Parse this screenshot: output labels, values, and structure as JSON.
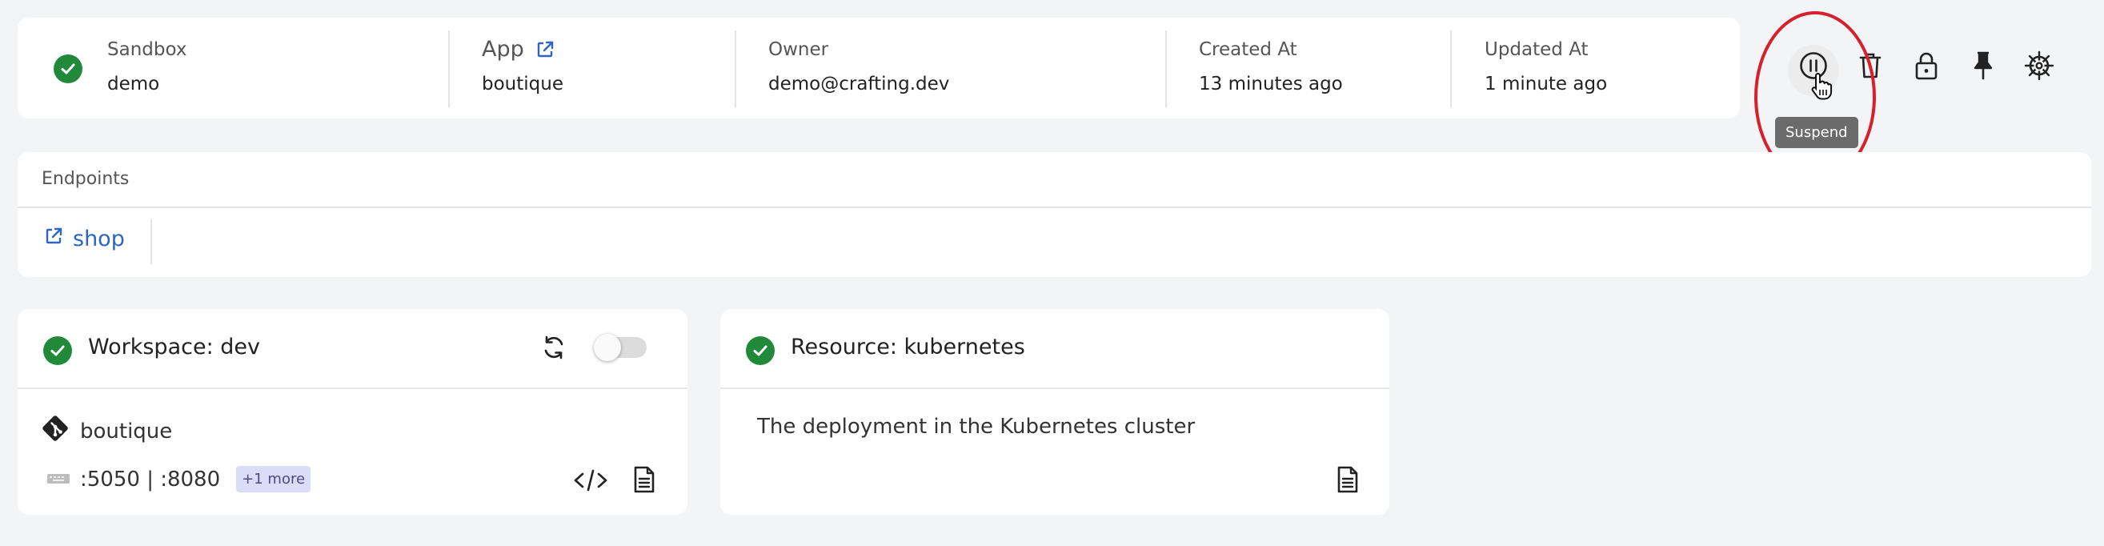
{
  "sandbox": {
    "label": "Sandbox",
    "name": "demo",
    "status": "ready"
  },
  "app": {
    "label": "App",
    "name": "boutique"
  },
  "owner": {
    "label": "Owner",
    "value": "demo@crafting.dev"
  },
  "created": {
    "label": "Created At",
    "value": "13 minutes ago"
  },
  "updated": {
    "label": "Updated At",
    "value": "1 minute ago"
  },
  "toolbar": {
    "actions": [
      "pause-icon",
      "trash-icon",
      "lock-icon",
      "pin-icon",
      "helm-icon"
    ],
    "tooltip": "Suspend"
  },
  "endpoints": {
    "title": "Endpoints",
    "items": [
      {
        "label": "shop"
      }
    ]
  },
  "workspace": {
    "title": "Workspace: dev",
    "repo": "boutique",
    "ports": ":5050 | :8080",
    "more_badge": "+1 more"
  },
  "resource": {
    "title": "Resource: kubernetes",
    "description": "The deployment in the Kubernetes cluster"
  },
  "colors": {
    "accent": "#2f64c2",
    "status_ok": "#218a3a",
    "highlight": "#d6202b"
  }
}
